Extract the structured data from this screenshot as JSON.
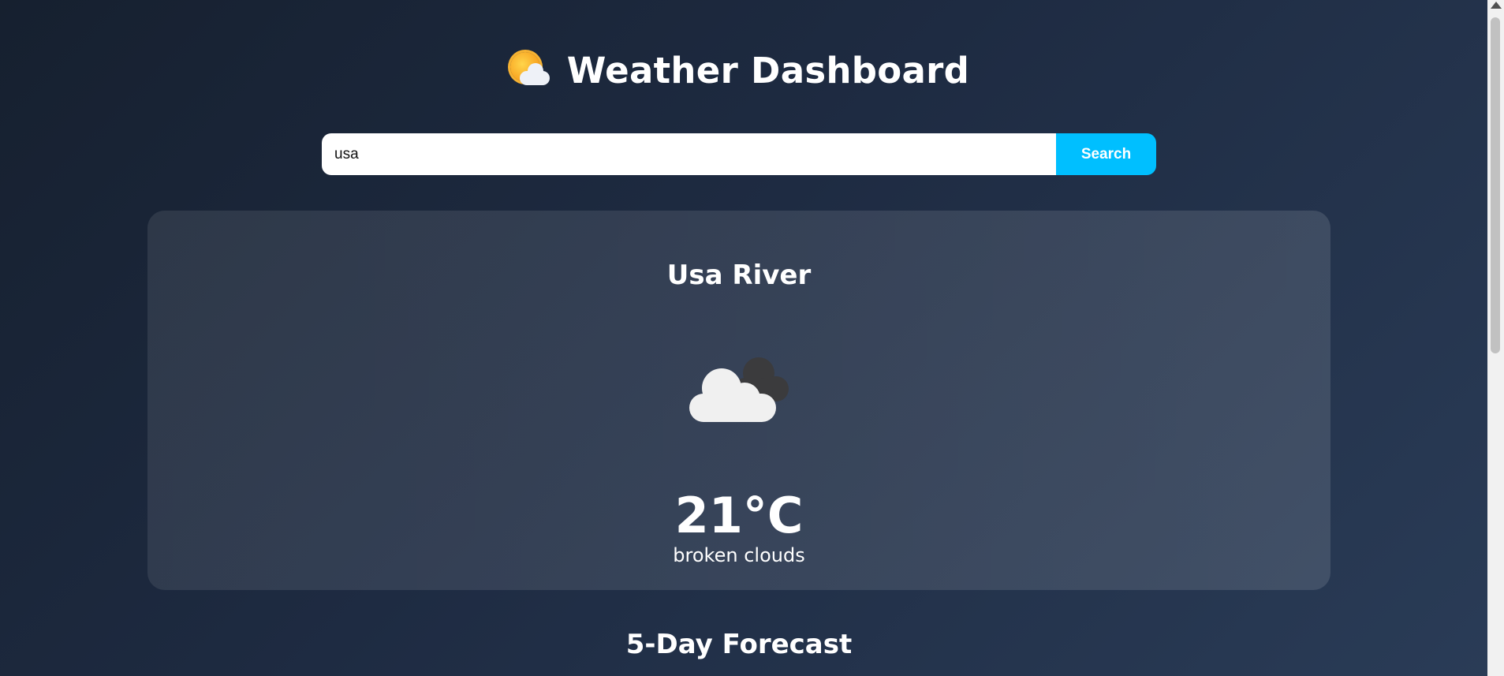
{
  "header": {
    "title": "Weather Dashboard",
    "logo_icon": "sun-behind-cloud-icon"
  },
  "search": {
    "value": "usa",
    "button_label": "Search"
  },
  "current_weather": {
    "city": "Usa River",
    "icon": "broken-clouds-icon",
    "temperature": "21°C",
    "description": "broken clouds"
  },
  "forecast": {
    "title": "5-Day Forecast"
  },
  "colors": {
    "accent": "#00bfff",
    "background_start": "#16202f",
    "background_end": "#2a3c57"
  }
}
